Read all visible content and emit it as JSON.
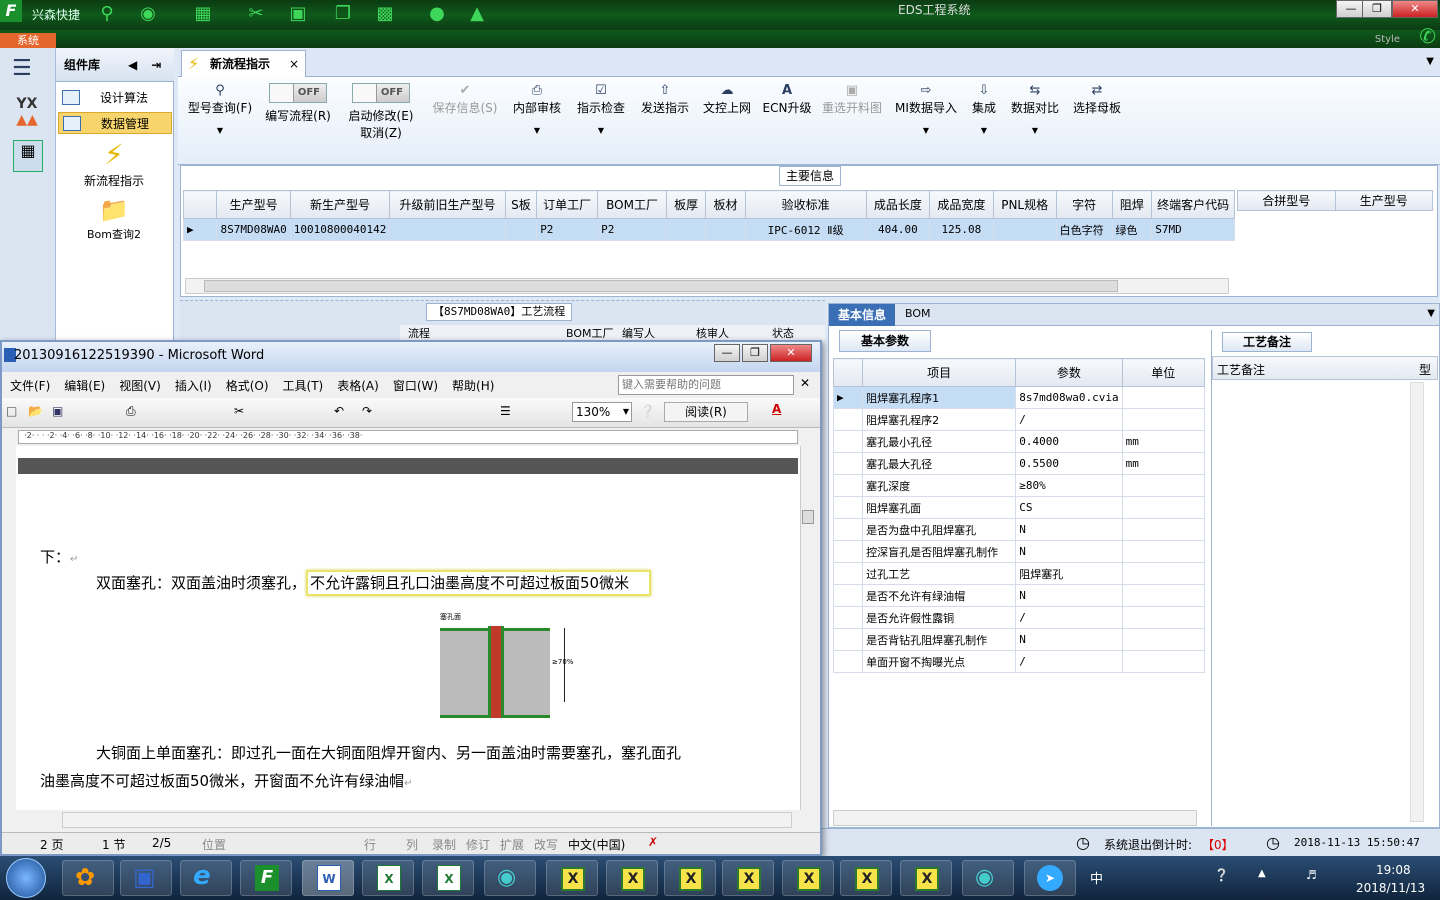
{
  "app": {
    "name": "兴森快捷",
    "title": "EDS工程系统",
    "system_btn": "系统",
    "style_label": "Style"
  },
  "nav": {
    "complib_title": "组件库",
    "items": [
      "设计算法",
      "数据管理"
    ],
    "tools": [
      "新流程指示",
      "Bom查询2"
    ]
  },
  "tab": {
    "label": "新流程指示"
  },
  "ribbon": {
    "buttons": [
      {
        "label": "型号查询(F)",
        "icon": "search-icon",
        "dis": false
      },
      {
        "label": "保存信息(S)",
        "icon": "check-icon",
        "dis": true
      },
      {
        "label": "内部审核",
        "icon": "print-icon",
        "dis": false
      },
      {
        "label": "指示检查",
        "icon": "checkbox-icon",
        "dis": false
      },
      {
        "label": "发送指示",
        "icon": "upload-icon",
        "dis": false
      },
      {
        "label": "文控上网",
        "icon": "cloud-upload-icon",
        "dis": false
      },
      {
        "label": "ECN升级",
        "icon": "ecn-icon",
        "dis": false
      },
      {
        "label": "重选开料图",
        "icon": "image-icon",
        "dis": true
      },
      {
        "label": "MI数据导入",
        "icon": "import-icon",
        "dis": false
      },
      {
        "label": "集成",
        "icon": "download-icon",
        "dis": false
      },
      {
        "label": "数据对比",
        "icon": "compare-icon",
        "dis": false
      },
      {
        "label": "选择母板",
        "icon": "shuffle-icon",
        "dis": false
      }
    ],
    "toggle1": {
      "label": "编写流程(R)",
      "state": "OFF"
    },
    "toggle2": {
      "label": "启动修改(E)",
      "label2": "取消(Z)",
      "state": "OFF"
    }
  },
  "main_info": {
    "title": "主要信息",
    "headers": [
      "生产型号",
      "新生产型号",
      "升级前旧生产型号",
      "S板",
      "订单工厂",
      "BOM工厂",
      "板厚",
      "板材",
      "验收标准",
      "成品长度",
      "成品宽度",
      "PNL规格",
      "字符",
      "阻焊",
      "终端客户代码"
    ],
    "row": [
      "8S7MD08WA0",
      "10010800040142",
      "",
      "",
      "P2",
      "P2",
      "",
      "",
      "IPC-6012 Ⅱ级",
      "404.00",
      "125.08",
      "",
      "白色字符",
      "绿色",
      "S7MD"
    ],
    "side_headers": [
      "合拼型号",
      "生产型号"
    ]
  },
  "process": {
    "title": "【8S7MD08WA0】工艺流程",
    "cols": [
      "流程",
      "BOM工厂",
      "编写人",
      "核审人",
      "状态"
    ]
  },
  "basic": {
    "tabs": [
      "基本信息",
      "BOM"
    ],
    "subtab": "基本参数",
    "headers": [
      "项目",
      "参数",
      "单位"
    ],
    "rows": [
      [
        "阻焊塞孔程序1",
        "8s7md08wa0.cvia",
        ""
      ],
      [
        "阻焊塞孔程序2",
        "/",
        ""
      ],
      [
        "塞孔最小孔径",
        "0.4000",
        "mm"
      ],
      [
        "塞孔最大孔径",
        "0.5500",
        "mm"
      ],
      [
        "塞孔深度",
        "≥80%",
        ""
      ],
      [
        "阻焊塞孔面",
        "CS",
        ""
      ],
      [
        "是否为盘中孔阻焊塞孔",
        "N",
        ""
      ],
      [
        "控深盲孔是否阻焊塞孔制作",
        "N",
        ""
      ],
      [
        "过孔工艺",
        "阻焊塞孔",
        ""
      ],
      [
        "是否不允许有绿油帽",
        "N",
        ""
      ],
      [
        "是否允许假性露铜",
        "/",
        ""
      ],
      [
        "是否背钻孔阻焊塞孔制作",
        "N",
        ""
      ],
      [
        "单面开窗不掏曝光点",
        "/",
        ""
      ]
    ],
    "remark_tab": "工艺备注",
    "remark_header": "工艺备注",
    "remark_header2": "型"
  },
  "status": {
    "countdown_label": "系统退出倒计时:",
    "countdown_value": "【0】",
    "datetime": "2018-11-13 15:50:47"
  },
  "word": {
    "title": "20130916122519390 - Microsoft Word",
    "menus": [
      "文件(F)",
      "编辑(E)",
      "视图(V)",
      "插入(I)",
      "格式(O)",
      "工具(T)",
      "表格(A)",
      "窗口(W)",
      "帮助(H)"
    ],
    "help_placeholder": "键入需要帮助的问题",
    "zoom": "130%",
    "read_btn": "阅读(R)",
    "doc": {
      "line1": "下：",
      "line2a": "双面塞孔：双面盖油时须塞孔，",
      "line2b": "不允许露铜且孔口油墨高度不可超过板面50微米",
      "fig_label": "塞孔面",
      "fig_pct": "≥70%",
      "line3": "大铜面上单面塞孔：即过孔一面在大铜面阻焊开窗内、另一面盖油时需要塞孔，塞孔面孔",
      "line4": "油墨高度不可超过板面50微米，开窗面不允许有绿油帽"
    },
    "status": [
      "2 页",
      "1 节",
      "2/5",
      "位置",
      "行",
      "列",
      "录制",
      "修订",
      "扩展",
      "改写",
      "中文(中国)"
    ]
  },
  "taskbar": {
    "time": "19:08",
    "date": "2018/11/13",
    "ime": "中"
  }
}
